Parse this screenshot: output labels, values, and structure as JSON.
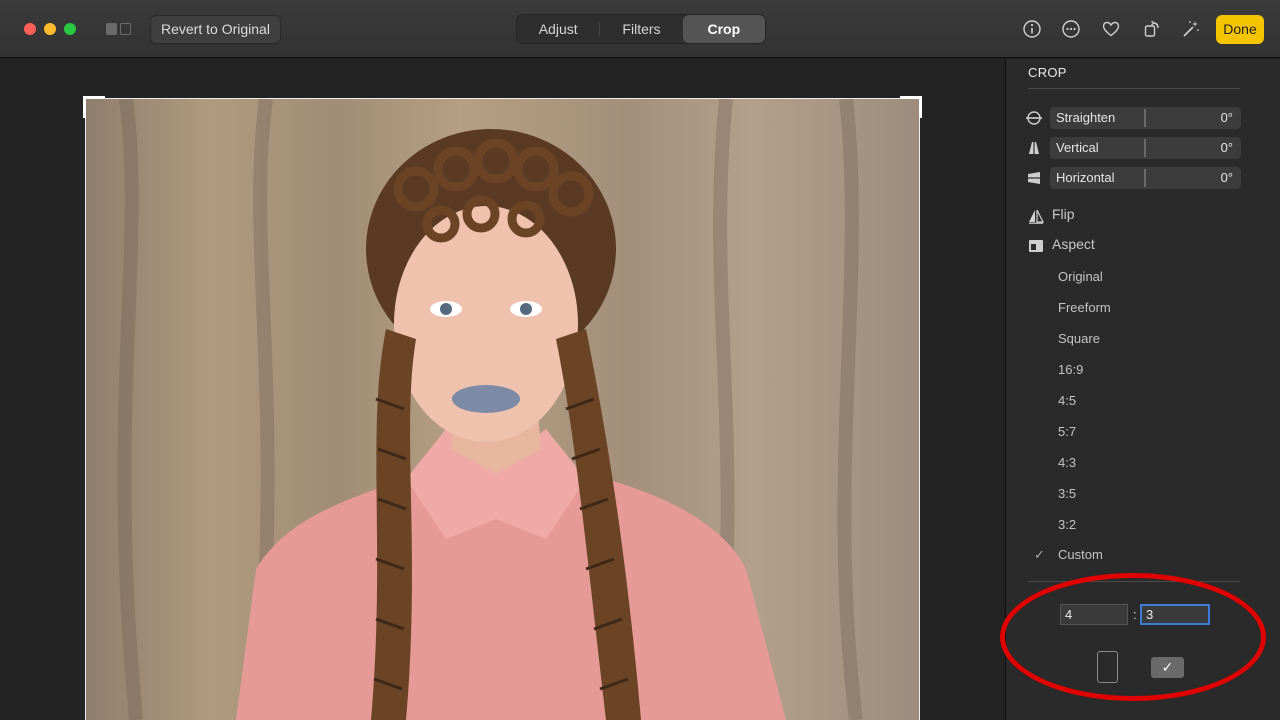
{
  "toolbar": {
    "revert_label": "Revert to Original",
    "tabs": [
      {
        "label": "Adjust",
        "active": false
      },
      {
        "label": "Filters",
        "active": false
      },
      {
        "label": "Crop",
        "active": true
      }
    ],
    "icons": [
      "info-icon",
      "more-icon",
      "favorite-heart-icon",
      "rotate-icon",
      "auto-enhance-wand-icon"
    ],
    "done_label": "Done",
    "done_color": "#f5c400"
  },
  "sidebar": {
    "title": "CROP",
    "sliders": [
      {
        "label": "Straighten",
        "value": "0°",
        "icon": "straighten-icon"
      },
      {
        "label": "Vertical",
        "value": "0°",
        "icon": "vertical-perspective-icon"
      },
      {
        "label": "Horizontal",
        "value": "0°",
        "icon": "horizontal-perspective-icon"
      }
    ],
    "flip_label": "Flip",
    "aspect_label": "Aspect",
    "aspect_options": [
      "Original",
      "Freeform",
      "Square",
      "16:9",
      "4:5",
      "5:7",
      "4:3",
      "3:5",
      "3:2",
      "Custom"
    ],
    "selected_aspect": "Custom",
    "check_mark": "✓",
    "custom_ratio": {
      "width": "4",
      "height": "3",
      "separator": ":"
    },
    "landscape_check": "✓"
  },
  "annotation_color": "#e00000"
}
